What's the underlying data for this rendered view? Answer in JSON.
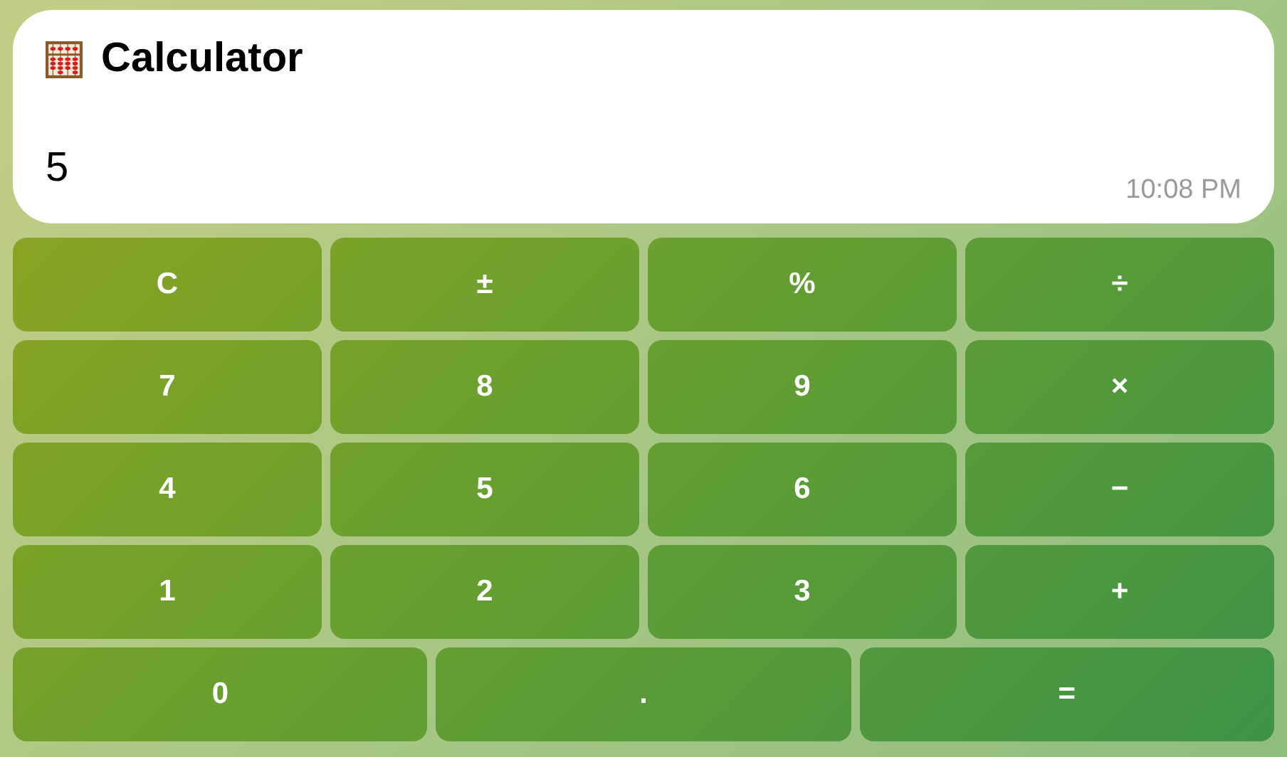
{
  "message": {
    "title": "Calculator",
    "text": "5",
    "time": "10:08 PM"
  },
  "keyboard": [
    [
      "C",
      "±",
      "%",
      "÷"
    ],
    [
      "7",
      "8",
      "9",
      "×"
    ],
    [
      "4",
      "5",
      "6",
      "−"
    ],
    [
      "1",
      "2",
      "3",
      "+"
    ],
    [
      "0",
      ".",
      "="
    ]
  ]
}
